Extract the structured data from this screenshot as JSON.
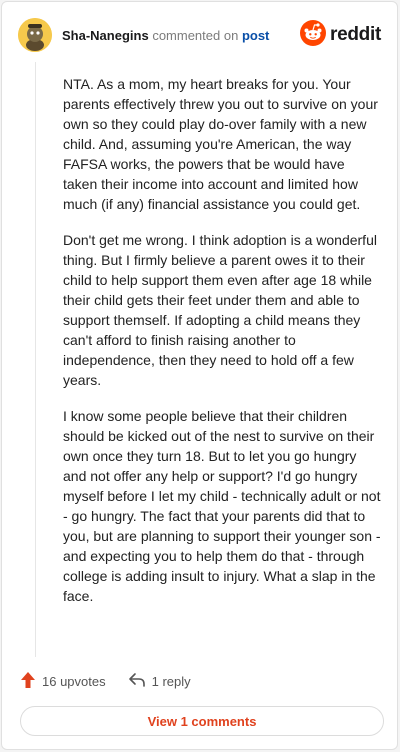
{
  "header": {
    "username": "Sha-Nanegins",
    "action_text": "commented on",
    "post_link": "post",
    "brand": "reddit"
  },
  "comment": {
    "paragraphs": [
      "NTA. As a mom, my heart breaks for you. Your parents effectively threw you out to survive on your own so they could play do-over family with a new child. And, assuming you're American, the way FAFSA works, the powers that be would have taken their income into account and limited how much (if any) financial assistance you could get.",
      "Don't get me wrong. I think adoption is a wonderful thing. But I firmly believe a parent owes it to their child to help support them even after age 18 while their child gets their feet under them and able to support themself. If adopting a child means they can't afford to finish raising another to independence, then they need to hold off a few years.",
      "I know some people believe that their children should be kicked out of the nest to survive on their own once they turn 18. But to let you go hungry and not offer any help or support? I'd go hungry myself before I let my child - technically adult or not - go hungry. The fact that your parents did that to you, but are planning to support their younger son - and expecting you to help them do that - through college is adding insult to injury. What a slap in the face."
    ]
  },
  "actions": {
    "upvotes": "16 upvotes",
    "replies": "1 reply",
    "view_comments": "View 1 comments"
  },
  "colors": {
    "accent": "#e0421e",
    "link": "#0a4fa8",
    "avatar": "#f6c94c"
  },
  "icons": [
    "avatar-icon",
    "reddit-logo-icon",
    "upvote-arrow-icon",
    "reply-arrow-icon"
  ]
}
